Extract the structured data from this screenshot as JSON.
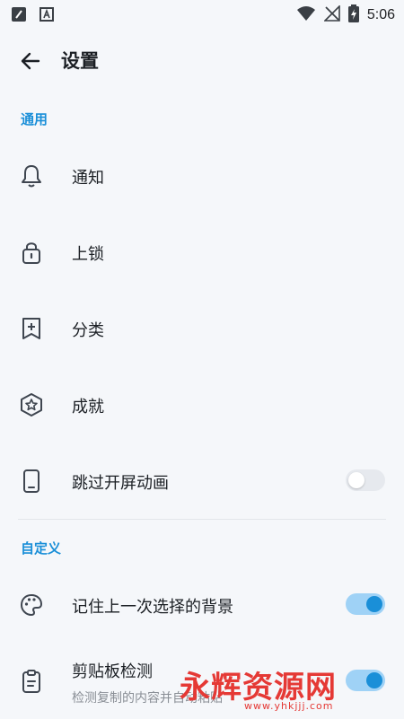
{
  "status_bar": {
    "time": "5:06"
  },
  "app_bar": {
    "title": "设置"
  },
  "sections": {
    "general": {
      "header": "通用",
      "items": [
        {
          "label": "通知",
          "icon": "bell-icon"
        },
        {
          "label": "上锁",
          "icon": "lock-icon"
        },
        {
          "label": "分类",
          "icon": "bookmark-plus-icon"
        },
        {
          "label": "成就",
          "icon": "star-badge-icon"
        },
        {
          "label": "跳过开屏动画",
          "icon": "phone-icon",
          "toggle": false
        }
      ]
    },
    "custom": {
      "header": "自定义",
      "items": [
        {
          "label": "记住上一次选择的背景",
          "icon": "palette-icon",
          "toggle": true
        },
        {
          "label": "剪贴板检测",
          "sublabel": "检测复制的内容并自动粘贴",
          "icon": "clipboard-icon",
          "toggle": true
        }
      ]
    }
  },
  "watermark": {
    "brand": "永辉资源网",
    "url": "www.yhkjjj.com"
  },
  "colors": {
    "accent": "#1a8fd8",
    "background": "#f5f7fa",
    "watermark": "#e53935"
  }
}
